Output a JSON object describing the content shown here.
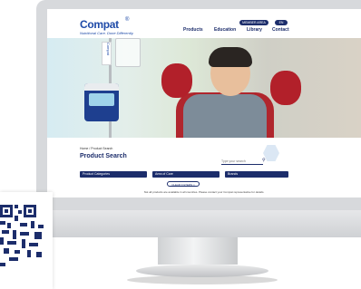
{
  "brand": {
    "logo": "Compat",
    "mark": "®",
    "tagline": "Nutritional Care. Done Differently."
  },
  "utility": {
    "members": "MEMBER AREA",
    "language": "EN"
  },
  "nav": {
    "items": [
      "Products",
      "Education",
      "Library",
      "Contact"
    ]
  },
  "hero": {
    "bag_label": "Compat"
  },
  "search": {
    "breadcrumb": "Home  /  Product Search",
    "title": "Product Search",
    "keyword_placeholder": "Type your search",
    "filters": [
      "Product Categories",
      "Area of Care",
      "Brands"
    ],
    "clear_label": "CLEAR FILTERS ×",
    "note": "Not all products are available in all countries. Please contact your Compat representative for details."
  },
  "colors": {
    "navy": "#1c2d6b",
    "brand_blue": "#1e4aa8"
  }
}
